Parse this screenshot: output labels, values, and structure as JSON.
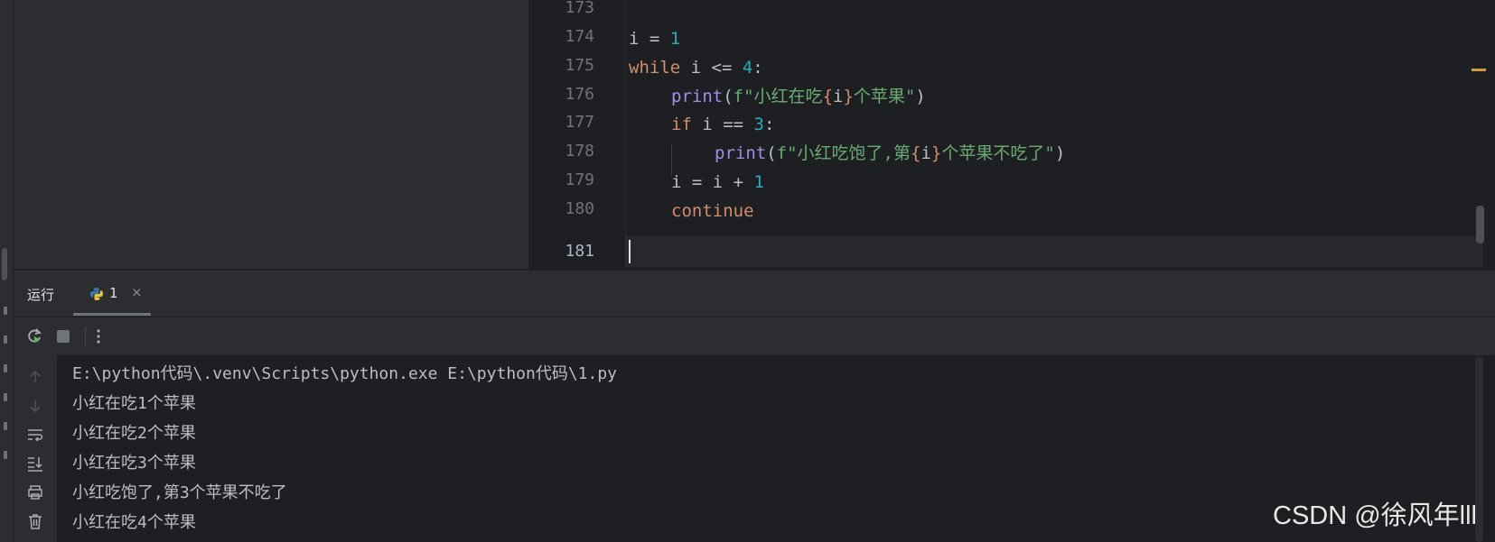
{
  "editor": {
    "line_numbers": [
      "173",
      "174",
      "175",
      "176",
      "177",
      "178",
      "179",
      "180",
      "181"
    ],
    "current_line": "181",
    "code": {
      "l174": {
        "var": "i",
        "op": " = ",
        "num": "1"
      },
      "l175": {
        "kw": "while",
        "rest": " i <= ",
        "num": "4",
        "colon": ":"
      },
      "l176": {
        "fn": "print",
        "open": "(",
        "prefix": "f",
        "str1": "\"小红在吃",
        "lbrace": "{",
        "var": "i",
        "rbrace": "}",
        "str2": "个苹果\"",
        "close": ")"
      },
      "l177": {
        "kw": "if",
        "rest": " i == ",
        "num": "3",
        "colon": ":"
      },
      "l178": {
        "fn": "print",
        "open": "(",
        "prefix": "f",
        "str1": "\"小红吃饱了,第",
        "lbrace": "{",
        "var": "i",
        "rbrace": "}",
        "str2": "个苹果不吃了\"",
        "close": ")"
      },
      "l179": {
        "rest": "i = i + ",
        "num": "1"
      },
      "l180": {
        "kw": "continue"
      }
    }
  },
  "run_panel": {
    "title": "运行",
    "tab_label": "1",
    "tab_close": "×",
    "toolbar": {
      "rerun_icon": "rerun-icon",
      "stop_icon": "stop-icon",
      "more_icon": "more-vertical-icon"
    },
    "side_icons": [
      "arrow-up-icon",
      "arrow-down-icon",
      "soft-wrap-icon",
      "scroll-to-end-icon",
      "print-icon",
      "trash-icon"
    ],
    "output": [
      "E:\\python代码\\.venv\\Scripts\\python.exe E:\\python代码\\1.py",
      "小红在吃1个苹果",
      "小红在吃2个苹果",
      "小红在吃3个苹果",
      "小红吃饱了,第3个苹果不吃了",
      "小红在吃4个苹果"
    ]
  },
  "watermark": "CSDN @徐风年lll"
}
